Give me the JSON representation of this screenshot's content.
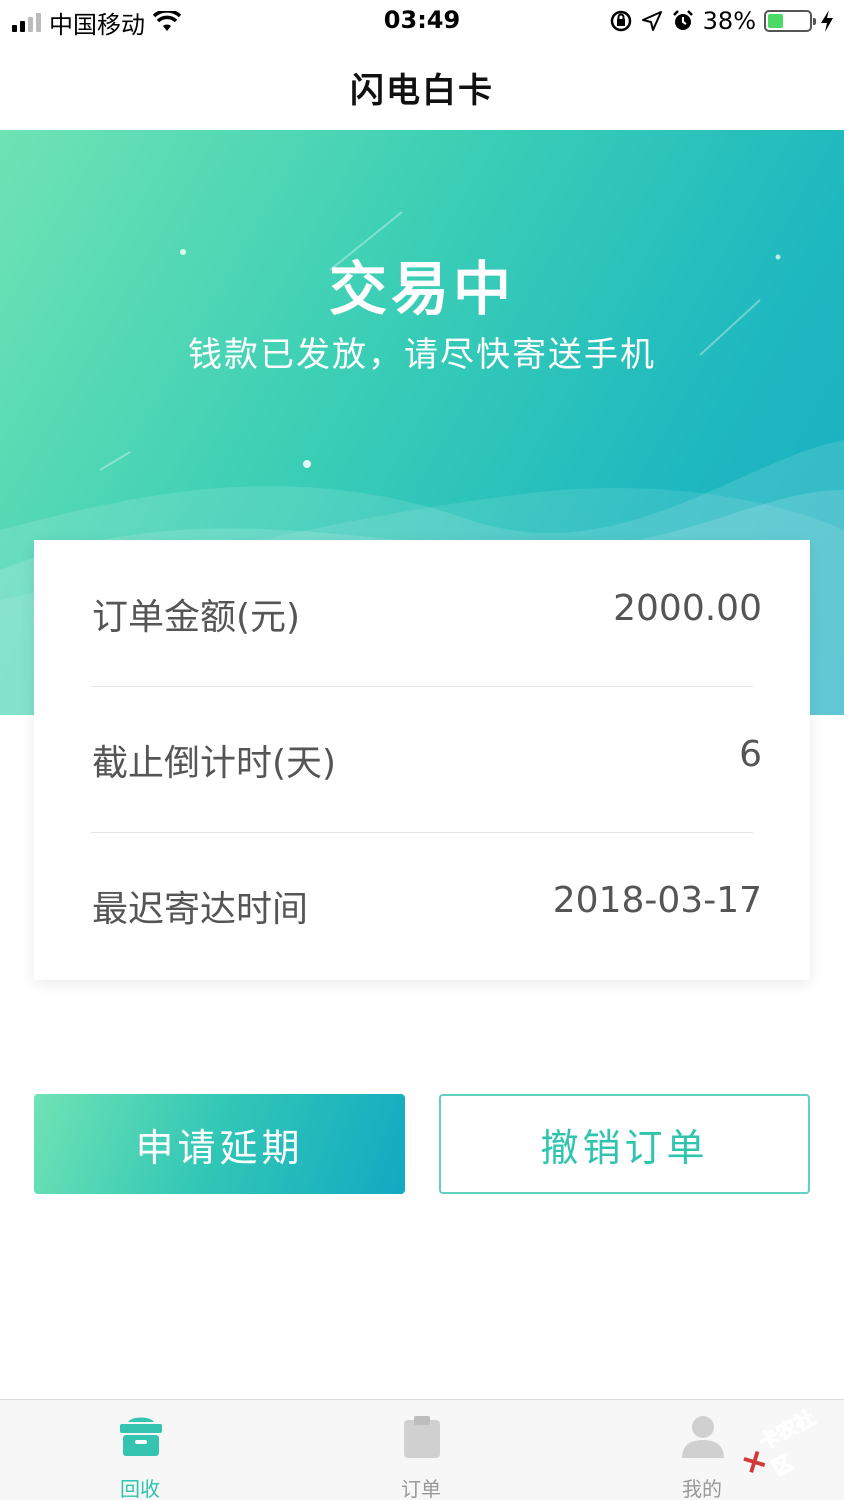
{
  "status_bar": {
    "carrier": "中国移动",
    "time": "03:49",
    "battery_percent": "38%",
    "battery_level": 0.38,
    "icons": [
      "signal-icon",
      "wifi-icon",
      "orientation-lock-icon",
      "location-icon",
      "alarm-icon",
      "battery-icon",
      "charging-icon"
    ]
  },
  "nav": {
    "title": "闪电白卡"
  },
  "hero": {
    "title": "交易中",
    "subtitle": "钱款已发放，请尽快寄送手机"
  },
  "order_card": {
    "rows": [
      {
        "label": "订单金额(元)",
        "value": "2000.00"
      },
      {
        "label": "截止倒计时(天)",
        "value": "6"
      },
      {
        "label": "最迟寄达时间",
        "value": "2018-03-17"
      }
    ]
  },
  "actions": {
    "extend_label": "申请延期",
    "cancel_label": "撤销订单"
  },
  "tab_bar": {
    "tabs": [
      {
        "label": "回收",
        "icon": "recycle-box-icon",
        "active": true
      },
      {
        "label": "订单",
        "icon": "clipboard-icon",
        "active": false
      },
      {
        "label": "我的",
        "icon": "user-icon",
        "active": false
      }
    ]
  },
  "watermark": {
    "text": "卡农社区"
  },
  "colors": {
    "accent": "#2ec4ad",
    "gradient_start": "#6fe3b4",
    "gradient_end": "#13a9c3",
    "tab_inactive": "#999999"
  }
}
